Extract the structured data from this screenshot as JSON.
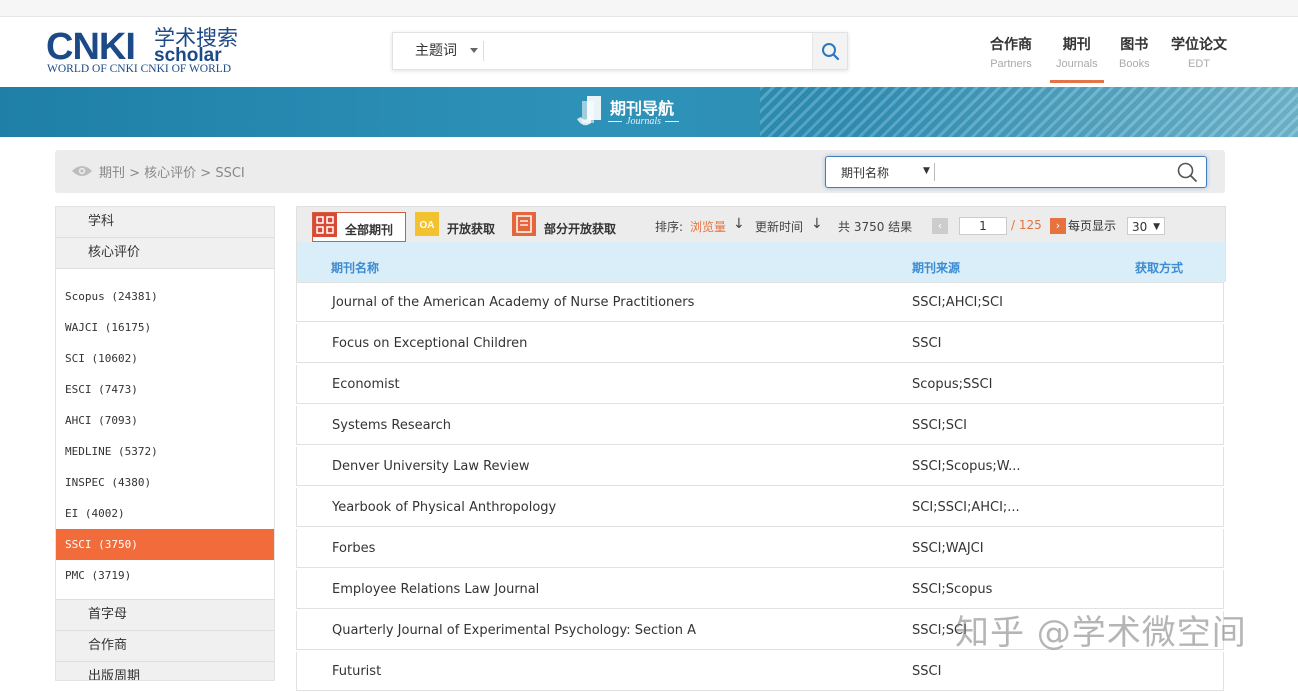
{
  "logo": {
    "latin": "CNKI",
    "cn": "学术搜索",
    "scholar": "scholar",
    "tagline": "WORLD OF CNKI CNKI OF WORLD"
  },
  "header_search": {
    "type_label": "主题词",
    "value": "",
    "placeholder": ""
  },
  "nav": [
    {
      "zh": "合作商",
      "en": "Partners",
      "active": false
    },
    {
      "zh": "期刊",
      "en": "Journals",
      "active": true
    },
    {
      "zh": "图书",
      "en": "Books",
      "active": false
    },
    {
      "zh": "学位论文",
      "en": "EDT",
      "active": false
    }
  ],
  "banner": {
    "title": "期刊导航",
    "subtitle": "Journals"
  },
  "breadcrumb": "期刊 > 核心评价 > SSCI",
  "journal_search": {
    "type_label": "期刊名称",
    "value": ""
  },
  "sidebar": {
    "subject_label": "学科",
    "core_label": "核心评价",
    "core_items": [
      {
        "label": "Scopus (24381)",
        "active": false
      },
      {
        "label": "WAJCI (16175)",
        "active": false
      },
      {
        "label": "SCI (10602)",
        "active": false
      },
      {
        "label": "ESCI (7473)",
        "active": false
      },
      {
        "label": "AHCI (7093)",
        "active": false
      },
      {
        "label": "MEDLINE (5372)",
        "active": false
      },
      {
        "label": "INSPEC (4380)",
        "active": false
      },
      {
        "label": "EI (4002)",
        "active": false
      },
      {
        "label": "SSCI (3750)",
        "active": true
      },
      {
        "label": "PMC (3719)",
        "active": false
      }
    ],
    "letter_label": "首字母",
    "partner_label": "合作商",
    "period_label": "出版周期"
  },
  "toolbar": {
    "tab_all": "全部期刊",
    "tab_open": "开放获取",
    "tab_partial": "部分开放获取",
    "sort_label": "排序:",
    "sort_views": "浏览量",
    "sort_updated": "更新时间",
    "total": "共 3750 结果",
    "page_value": "1",
    "page_total": "/ 125",
    "per_page_label": "每页显示",
    "per_page_value": "30"
  },
  "table": {
    "col_name": "期刊名称",
    "col_source": "期刊来源",
    "col_access": "获取方式",
    "rows": [
      {
        "name": "Journal of the American Academy of Nurse Practitioners",
        "source": "SSCI;AHCI;SCI",
        "access": ""
      },
      {
        "name": "Focus on Exceptional Children",
        "source": "SSCI",
        "access": ""
      },
      {
        "name": "Economist",
        "source": "Scopus;SSCI",
        "access": ""
      },
      {
        "name": "Systems Research",
        "source": "SSCI;SCI",
        "access": ""
      },
      {
        "name": "Denver University Law Review",
        "source": "SSCI;Scopus;W...",
        "access": ""
      },
      {
        "name": "Yearbook of Physical Anthropology",
        "source": "SCI;SSCI;AHCI;...",
        "access": ""
      },
      {
        "name": "Forbes",
        "source": "SSCI;WAJCI",
        "access": ""
      },
      {
        "name": "Employee Relations Law Journal",
        "source": "SSCI;Scopus",
        "access": ""
      },
      {
        "name": "Quarterly Journal of Experimental Psychology: Section A",
        "source": "SSCI;SCI",
        "access": ""
      },
      {
        "name": "Futurist",
        "source": "SSCI",
        "access": ""
      }
    ]
  },
  "watermark": "知乎 @学术微空间",
  "colors": {
    "brand_blue": "#1c4a86",
    "accent_orange": "#f26b3a",
    "link_blue": "#3d8bd1",
    "banner": "#2e92b8"
  }
}
